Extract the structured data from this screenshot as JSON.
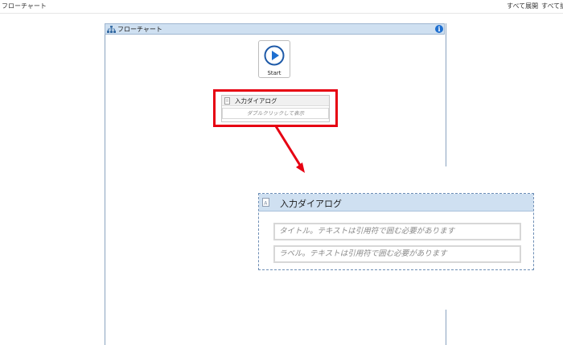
{
  "breadcrumb": {
    "label": "フローチャート"
  },
  "toolbar": {
    "expand_all": "すべて展開",
    "collapse_all": "すべて折"
  },
  "flowchart": {
    "title": "フローチャート",
    "info_icon": "info-icon"
  },
  "start": {
    "label": "Start",
    "icon": "play-icon"
  },
  "small_activity": {
    "title": "入力ダイアログ",
    "hint": "ダブルクリックして表示"
  },
  "big_activity": {
    "title": "入力ダイアログ",
    "title_placeholder": "タイトル。テキストは引用符で囲む必要があります",
    "label_placeholder": "ラベル。テキストは引用符で囲む必要があります"
  },
  "colors": {
    "header_blue": "#cfe0f1",
    "highlight_red": "#e60012",
    "play_blue": "#1e6fd0"
  }
}
